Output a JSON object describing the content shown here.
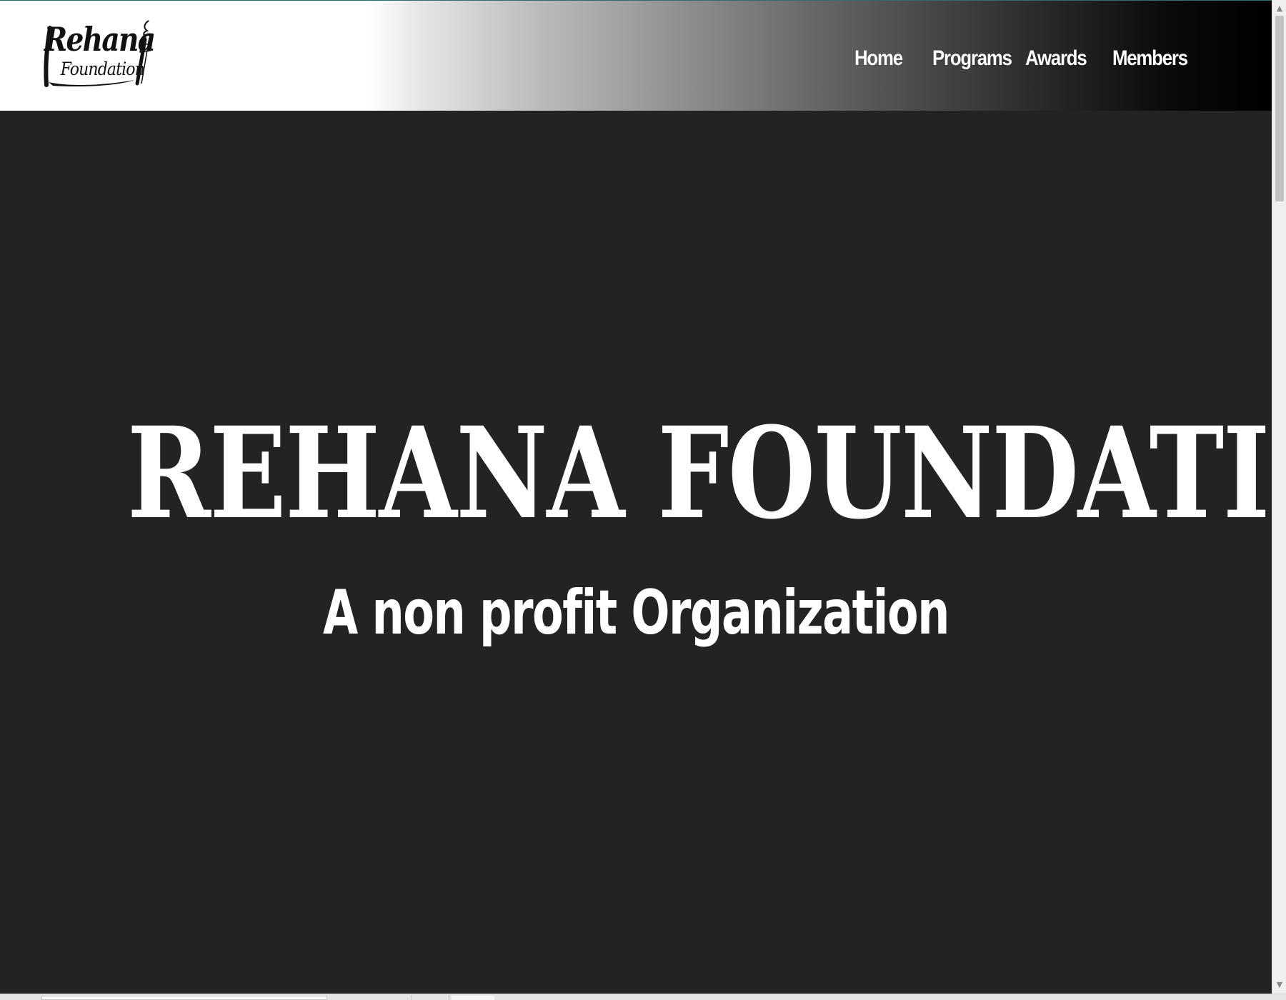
{
  "brand": {
    "logo_text_line1": "Rehana",
    "logo_text_line2": "Foundation"
  },
  "nav": {
    "items": [
      {
        "label": "Home"
      },
      {
        "label": "Programs"
      },
      {
        "label": "Awards"
      },
      {
        "label": "Members"
      }
    ]
  },
  "hero": {
    "title": "REHANA FOUNDATION",
    "subtitle": "A non profit Organization"
  },
  "colors": {
    "hero_background": "#232323",
    "hero_text": "#ffffff",
    "nav_text": "#ffffff",
    "header_gradient_start": "#ffffff",
    "header_gradient_end": "#000000"
  },
  "icons": {
    "logo_pen": "quill-pen-icon",
    "scroll_up": "triangle-up-icon",
    "scroll_down": "triangle-down-icon"
  }
}
